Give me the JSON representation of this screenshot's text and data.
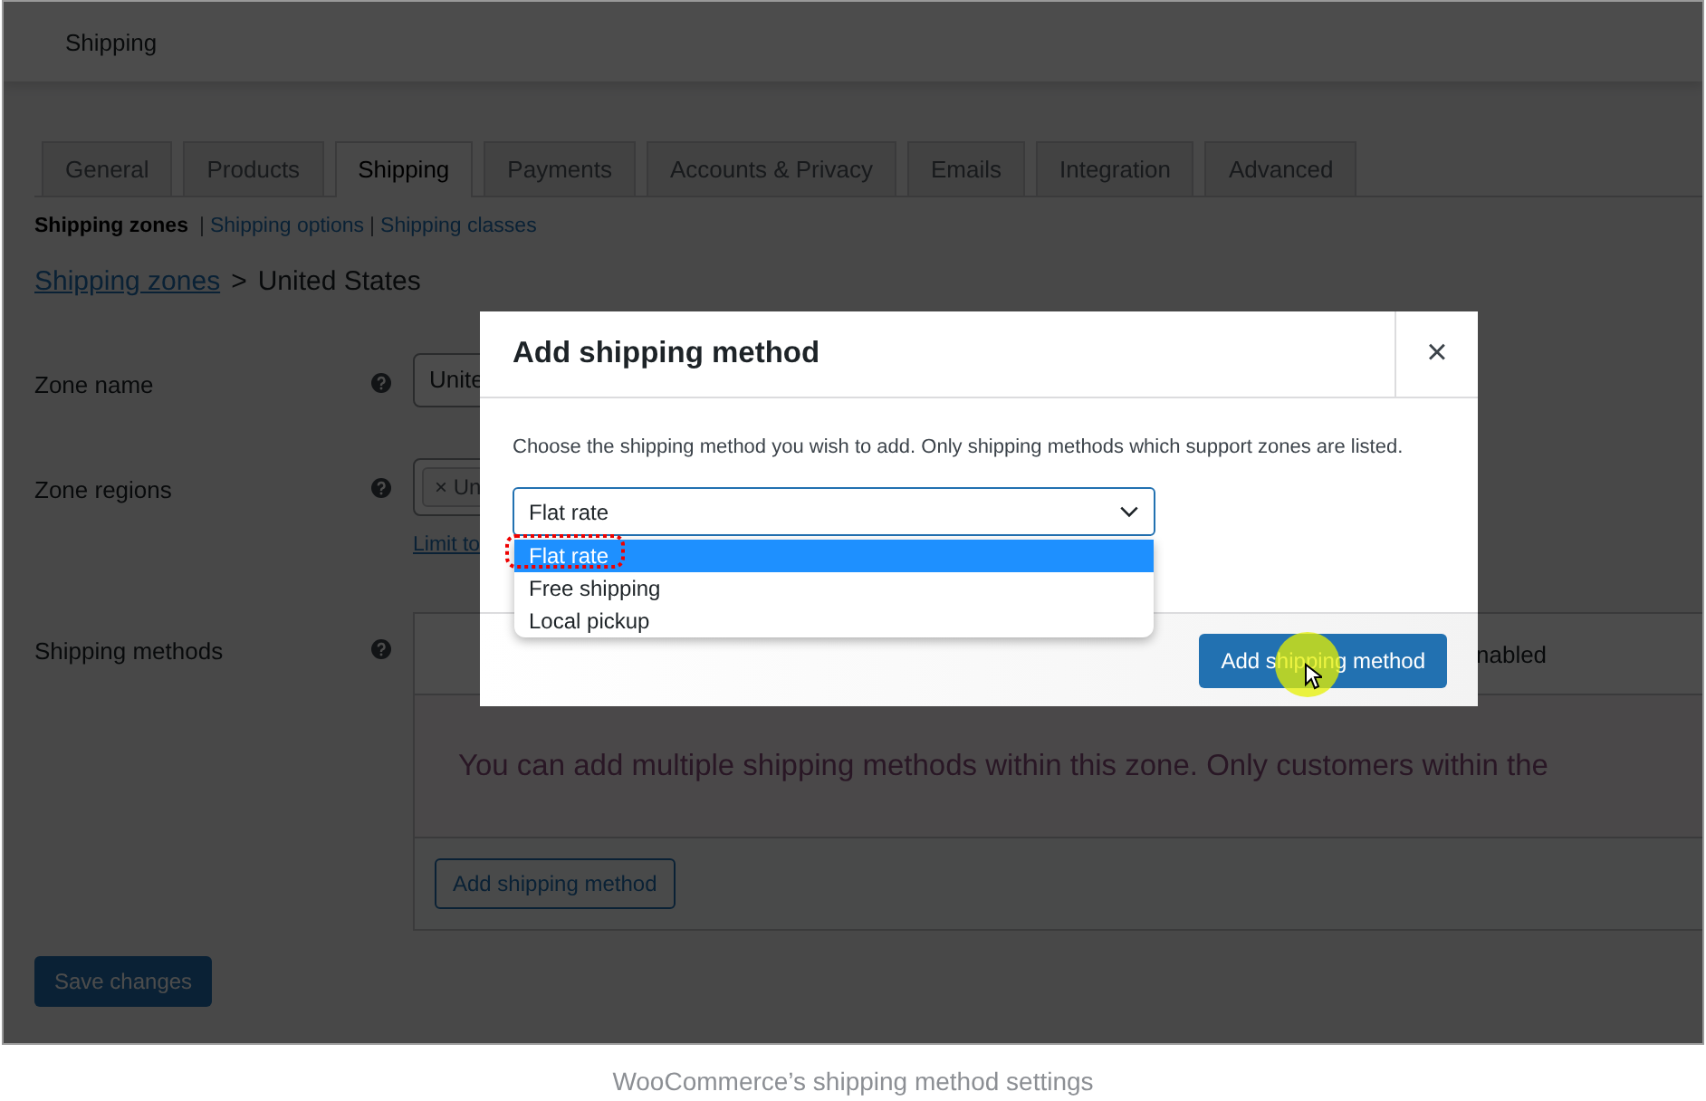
{
  "header": {
    "title": "Shipping"
  },
  "tabs": [
    {
      "label": "General",
      "selected": false
    },
    {
      "label": "Products",
      "selected": false
    },
    {
      "label": "Shipping",
      "selected": true
    },
    {
      "label": "Payments",
      "selected": false
    },
    {
      "label": "Accounts & Privacy",
      "selected": false
    },
    {
      "label": "Emails",
      "selected": false
    },
    {
      "label": "Integration",
      "selected": false
    },
    {
      "label": "Advanced",
      "selected": false
    }
  ],
  "subnav": [
    {
      "label": "Shipping zones",
      "selected": true
    },
    {
      "separator": "|",
      "label": "Shipping options",
      "selected": false
    },
    {
      "separator": "|",
      "label": "Shipping classes",
      "selected": false
    }
  ],
  "breadcrumb": {
    "link": "Shipping zones",
    "separator": ">",
    "current": "United States"
  },
  "fields": [
    {
      "kind": "text",
      "label": "Zone name",
      "value": "Unite"
    },
    {
      "kind": "tags",
      "label": "Zone regions",
      "tags": [
        {
          "remove": "×",
          "label": "Un"
        }
      ],
      "link": "Limit to"
    }
  ],
  "methods": {
    "label": "Shipping methods",
    "column_header": "nabled",
    "empty_text": "You can add multiple shipping methods within this zone. Only customers within the",
    "button": "Add shipping method"
  },
  "save_button": "Save changes",
  "modal": {
    "title": "Add shipping method",
    "close": "×",
    "description": "Choose the shipping method you wish to add. Only shipping methods which support zones are listed.",
    "select": {
      "value": "Flat rate",
      "options": [
        {
          "label": "Flat rate",
          "selected": true
        },
        {
          "label": "Free shipping",
          "selected": false
        },
        {
          "label": "Local pickup",
          "selected": false
        }
      ]
    },
    "button": "Add shipping method"
  },
  "caption": "WooCommerce’s shipping method settings"
}
